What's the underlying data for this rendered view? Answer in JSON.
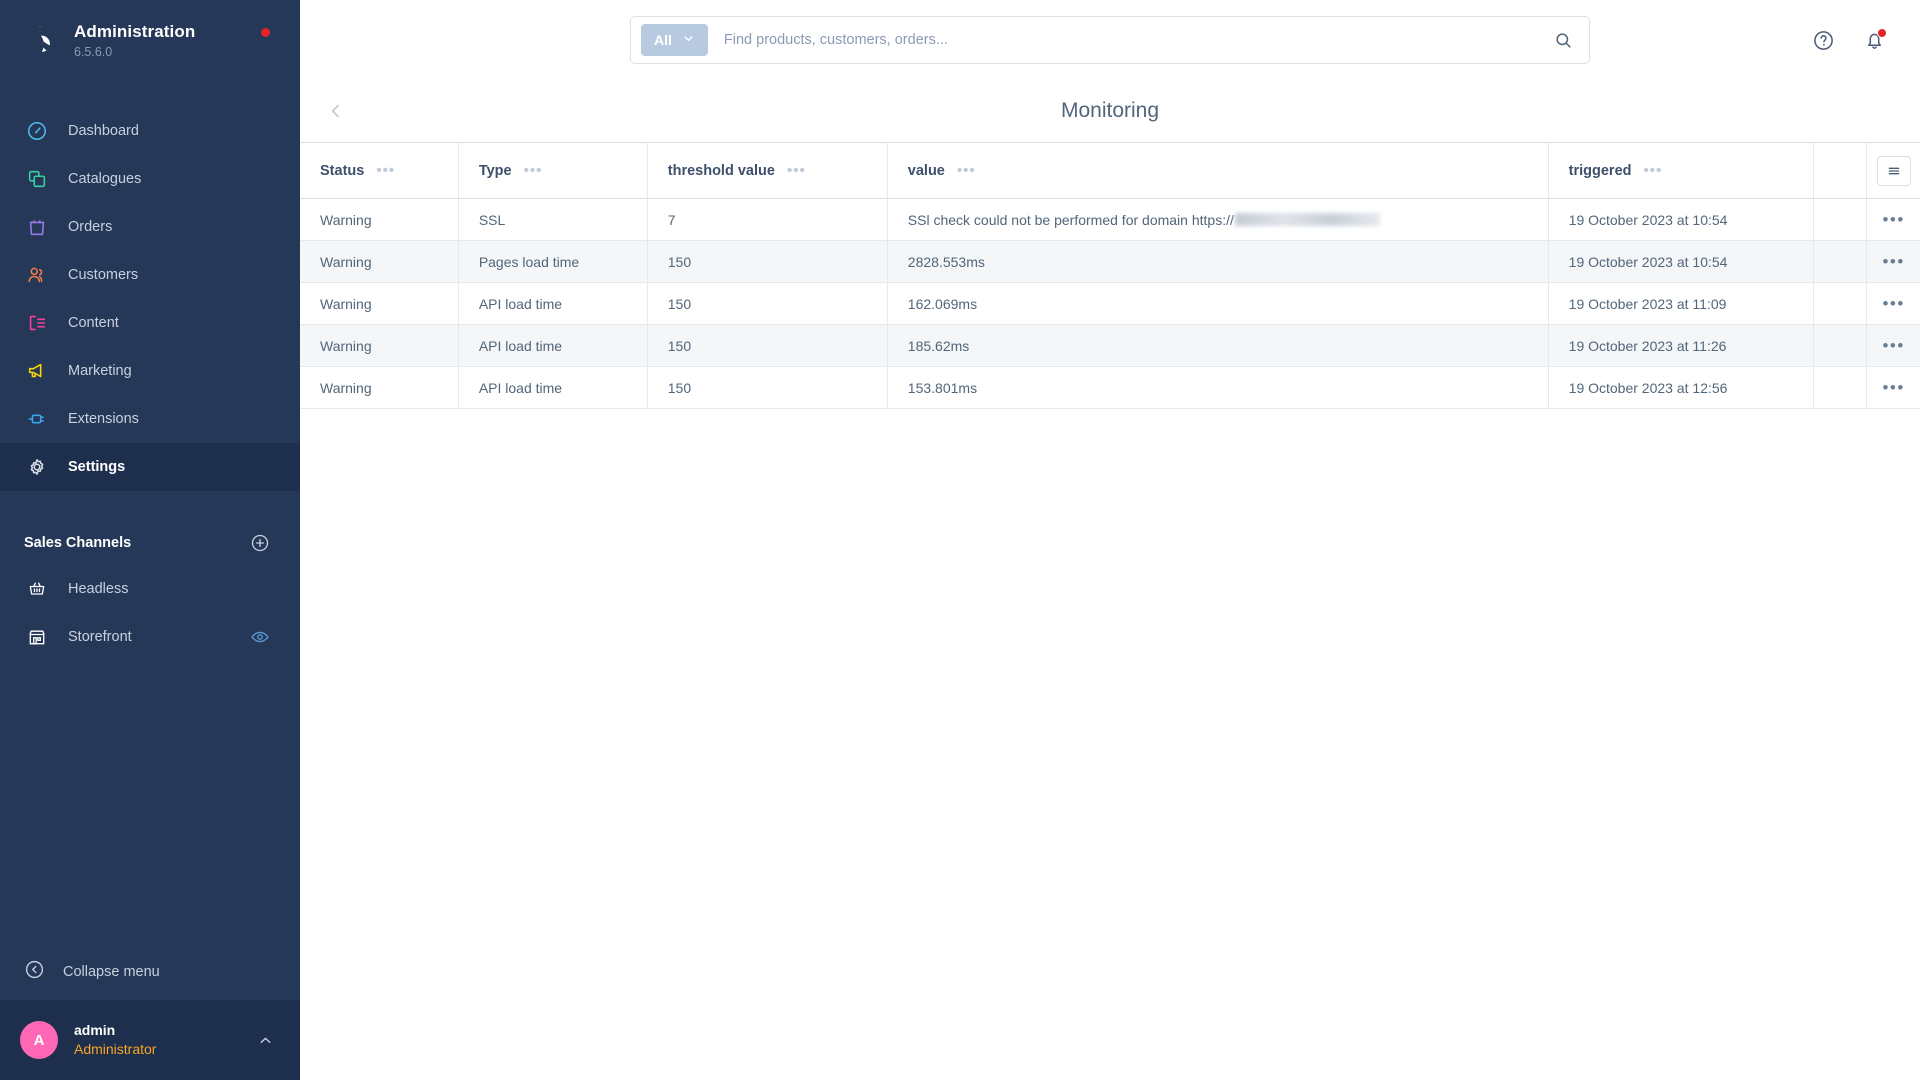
{
  "brand": {
    "title": "Administration",
    "version": "6.5.6.0",
    "logo_icon": "shopware-logo-icon",
    "status_dot_color": "#e52427"
  },
  "sidebar": {
    "items": [
      {
        "label": "Dashboard",
        "icon": "speedometer-icon",
        "color": "#4dbbeb",
        "active": false
      },
      {
        "label": "Catalogues",
        "icon": "layers-icon",
        "color": "#37d1a0",
        "active": false
      },
      {
        "label": "Orders",
        "icon": "bag-icon",
        "color": "#9b7ae8",
        "active": false
      },
      {
        "label": "Customers",
        "icon": "users-icon",
        "color": "#ef7b4b",
        "active": false
      },
      {
        "label": "Content",
        "icon": "content-icon",
        "color": "#f53fa0",
        "active": false
      },
      {
        "label": "Marketing",
        "icon": "megaphone-icon",
        "color": "#fad700",
        "active": false
      },
      {
        "label": "Extensions",
        "icon": "plug-icon",
        "color": "#3ba7ef",
        "active": false
      },
      {
        "label": "Settings",
        "icon": "gear-icon",
        "color": "#d7dde6",
        "active": true
      }
    ],
    "sales_channels": {
      "title": "Sales Channels",
      "add_icon": "plus-circle-icon",
      "items": [
        {
          "label": "Headless",
          "icon": "basket-icon",
          "trailing_icon": ""
        },
        {
          "label": "Storefront",
          "icon": "storefront-icon",
          "trailing_icon": "eye-icon"
        }
      ]
    },
    "collapse": {
      "label": "Collapse menu",
      "icon": "collapse-left-icon"
    },
    "user": {
      "initial": "A",
      "name": "admin",
      "role": "Administrator",
      "chevron_icon": "chevron-up-icon",
      "avatar_color": "#ff68b4",
      "role_color": "#f5a623"
    }
  },
  "topbar": {
    "scope_label": "All",
    "scope_chevron_icon": "chevron-down-icon",
    "search_placeholder": "Find products, customers, orders...",
    "search_value": "",
    "search_icon": "search-icon",
    "help_icon": "help-circle-icon",
    "notification_icon": "bell-icon",
    "notification_badge": true
  },
  "page": {
    "back_icon": "chevron-left-icon",
    "title": "Monitoring"
  },
  "table": {
    "columns": [
      {
        "label": "Status",
        "menu_icon": "column-menu-icon"
      },
      {
        "label": "Type",
        "menu_icon": "column-menu-icon"
      },
      {
        "label": "threshold value",
        "menu_icon": "column-menu-icon"
      },
      {
        "label": "value",
        "menu_icon": "column-menu-icon"
      },
      {
        "label": "triggered",
        "menu_icon": "column-menu-icon"
      }
    ],
    "settings_icon": "hamburger-menu-icon",
    "row_action_icon": "more-options-icon",
    "rows": [
      {
        "status": "Warning",
        "type": "SSL",
        "threshold": "7",
        "value": "SSl check could not be performed for domain https://",
        "value_redacted": true,
        "triggered": "19 October 2023 at 10:54"
      },
      {
        "status": "Warning",
        "type": "Pages load time",
        "threshold": "150",
        "value": "2828.553ms",
        "value_redacted": false,
        "triggered": "19 October 2023 at 10:54"
      },
      {
        "status": "Warning",
        "type": "API load time",
        "threshold": "150",
        "value": "162.069ms",
        "value_redacted": false,
        "triggered": "19 October 2023 at 11:09"
      },
      {
        "status": "Warning",
        "type": "API load time",
        "threshold": "150",
        "value": "185.62ms",
        "value_redacted": false,
        "triggered": "19 October 2023 at 11:26"
      },
      {
        "status": "Warning",
        "type": "API load time",
        "threshold": "150",
        "value": "153.801ms",
        "value_redacted": false,
        "triggered": "19 October 2023 at 12:56"
      }
    ]
  }
}
